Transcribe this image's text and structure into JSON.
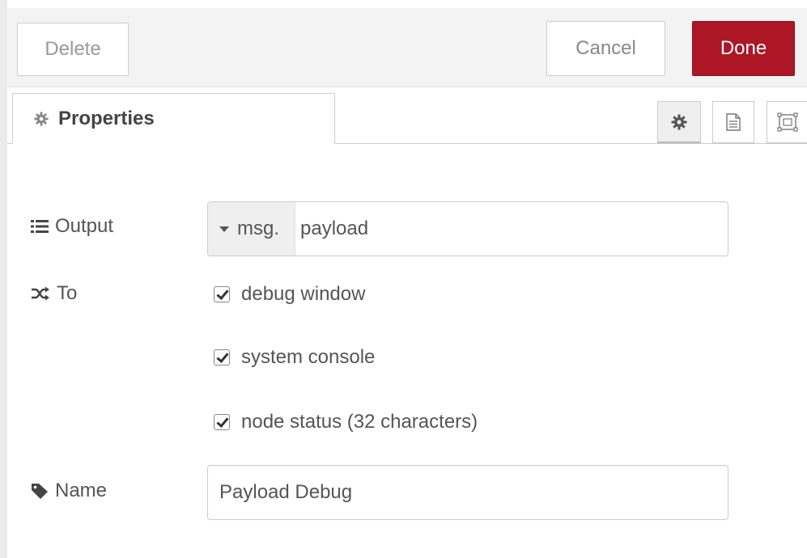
{
  "toolbar": {
    "delete_label": "Delete",
    "cancel_label": "Cancel",
    "done_label": "Done",
    "done_color": "#ad1625"
  },
  "tabs": {
    "properties_label": "Properties",
    "properties_icon": "gear-icon",
    "icon_buttons": [
      "gear-icon",
      "document-icon",
      "appearance-icon"
    ]
  },
  "form": {
    "output": {
      "label": "Output",
      "icon": "list-icon",
      "type_label": "msg.",
      "value": "payload"
    },
    "to": {
      "label": "To",
      "icon": "shuffle-icon",
      "options": [
        {
          "label": "debug window",
          "checked": true
        },
        {
          "label": "system console",
          "checked": true
        },
        {
          "label": "node status (32 characters)",
          "checked": true
        }
      ]
    },
    "name": {
      "label": "Name",
      "icon": "tag-icon",
      "value": "Payload Debug"
    }
  }
}
